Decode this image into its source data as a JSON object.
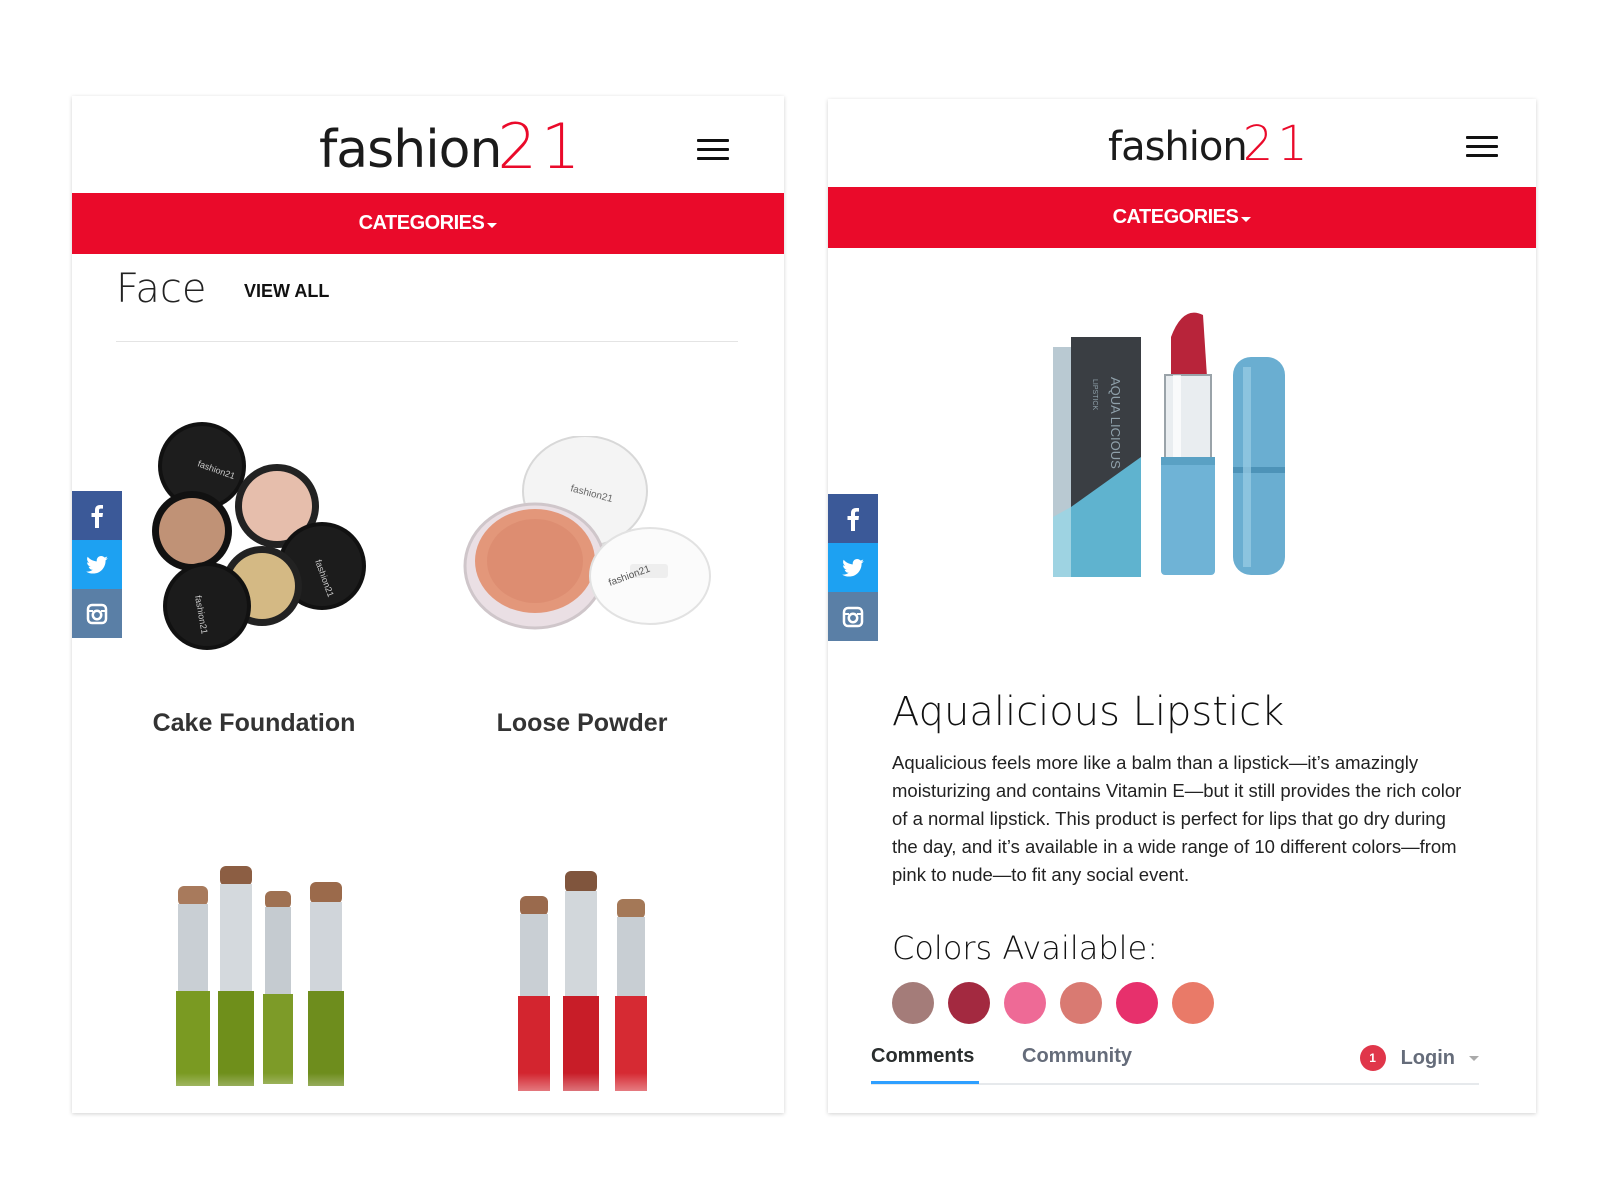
{
  "screens": {
    "left": {
      "logo": {
        "text": "fashion",
        "num": "21"
      },
      "categories_label": "CATEGORIES",
      "section_title": "Face",
      "view_all": "VIEW ALL",
      "products": [
        {
          "name": "Cake Foundation"
        },
        {
          "name": "Loose Powder"
        }
      ],
      "product_brand": "fashion21"
    },
    "right": {
      "logo": {
        "text": "fashion",
        "num": "21"
      },
      "categories_label": "CATEGORIES",
      "product_title": "Aqualicious Lipstick",
      "description": "Aqualicious feels more like a balm than a lipstick—it’s amazingly moisturizing and contains Vitamin E—but it still provides the rich color of a normal lipstick. This product is perfect for lips that go dry during the day, and it’s available in a wide range of 10 different colors—from pink to nude—to fit any social event.",
      "colors_title": "Colors Available:",
      "swatches": [
        "#a47c79",
        "#a32940",
        "#ee6a96",
        "#d97a72",
        "#e7306c",
        "#e97a68"
      ],
      "box_text": "AQUA LICIOUS",
      "box_subtext": "LIPSTICK",
      "comments": {
        "tab_comments": "Comments",
        "tab_community": "Community",
        "notification_count": "1",
        "login_label": "Login"
      }
    }
  },
  "social_icons": [
    "facebook-icon",
    "twitter-icon",
    "instagram-icon"
  ],
  "colors": {
    "brand_red": "#ea0a2a",
    "facebook": "#3b5998",
    "twitter": "#1da1f2",
    "instagram": "#5a7fa6"
  }
}
